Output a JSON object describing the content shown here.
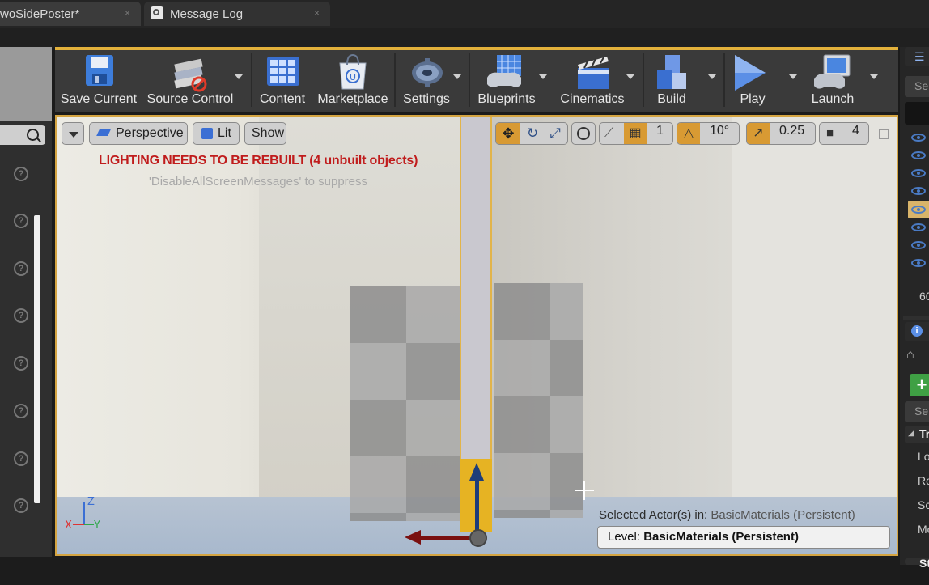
{
  "tabs": [
    {
      "label": "woSidePoster*",
      "close": "×"
    },
    {
      "label": "Message Log",
      "close": "×"
    }
  ],
  "toolbar": {
    "items": [
      {
        "label": "Save Current",
        "icon": "floppy-disk-icon"
      },
      {
        "label": "Source Control",
        "icon": "source-control-icon"
      },
      {
        "label": "Content",
        "icon": "content-grid-icon"
      },
      {
        "label": "Marketplace",
        "icon": "marketplace-bag-icon"
      },
      {
        "label": "Settings",
        "icon": "gear-icon"
      },
      {
        "label": "Blueprints",
        "icon": "blueprint-icon"
      },
      {
        "label": "Cinematics",
        "icon": "clapperboard-icon"
      },
      {
        "label": "Build",
        "icon": "build-blocks-icon"
      },
      {
        "label": "Play",
        "icon": "play-icon"
      },
      {
        "label": "Launch",
        "icon": "launch-console-icon"
      }
    ]
  },
  "viewport": {
    "view_mode": "Perspective",
    "lighting_mode": "Lit",
    "show_label": "Show",
    "camera_speed": "1",
    "rotation_snap": "10°",
    "scale_snap": "0.25",
    "camera_speed_value": "4",
    "warning": "LIGHTING NEEDS TO BE REBUILT (4 unbuilt objects)",
    "suppress_hint": "'DisableAllScreenMessages' to suppress",
    "selected_prefix": "Selected Actor(s) in:",
    "selected_level": "BasicMaterials (Persistent)",
    "level_label": "Level:",
    "level_value": "BasicMaterials (Persistent)",
    "axis_x": "X",
    "axis_y": "Y",
    "axis_z": "Z"
  },
  "right_panel": {
    "search_stub": "Se",
    "count_stub": "60",
    "search2_stub": "Se",
    "transform_stub": "Tr",
    "row_stubs": [
      "Lo",
      "Ro",
      "Sc",
      "Mo"
    ],
    "static_stub": "St",
    "add_label": "+"
  },
  "colors": {
    "accent": "#e3b13b",
    "warning": "#c01c1c",
    "add_green": "#3fa044"
  }
}
